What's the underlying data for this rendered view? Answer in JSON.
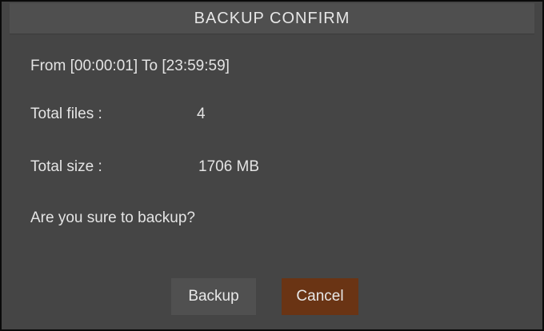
{
  "dialog": {
    "title": "BACKUP CONFIRM",
    "range_text": "From [00:00:01] To [23:59:59]",
    "total_files_label": "Total files :",
    "total_files_value": "4",
    "total_size_label": "Total size :",
    "total_size_value": "1706 MB",
    "question": "Are you sure to backup?",
    "backup_label": "Backup",
    "cancel_label": "Cancel"
  },
  "colors": {
    "background": "#454545",
    "title_bar": "#4f4f4f",
    "backup_button": "#505050",
    "cancel_button_selected": "#6a3414",
    "text": "#e4e4e4"
  }
}
